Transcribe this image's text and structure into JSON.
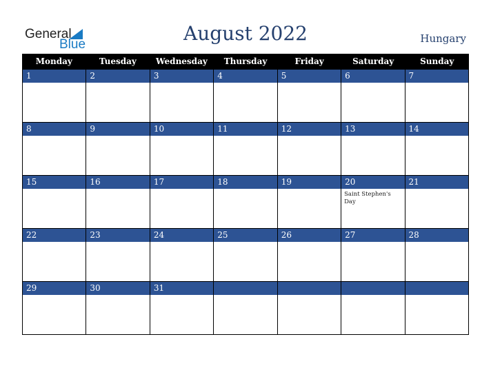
{
  "logo": {
    "general": "General",
    "blue": "Blue"
  },
  "title": "August 2022",
  "country": "Hungary",
  "weekdays": [
    "Monday",
    "Tuesday",
    "Wednesday",
    "Thursday",
    "Friday",
    "Saturday",
    "Sunday"
  ],
  "weeks": [
    [
      {
        "d": "1"
      },
      {
        "d": "2"
      },
      {
        "d": "3"
      },
      {
        "d": "4"
      },
      {
        "d": "5"
      },
      {
        "d": "6"
      },
      {
        "d": "7"
      }
    ],
    [
      {
        "d": "8"
      },
      {
        "d": "9"
      },
      {
        "d": "10"
      },
      {
        "d": "11"
      },
      {
        "d": "12"
      },
      {
        "d": "13"
      },
      {
        "d": "14"
      }
    ],
    [
      {
        "d": "15"
      },
      {
        "d": "16"
      },
      {
        "d": "17"
      },
      {
        "d": "18"
      },
      {
        "d": "19"
      },
      {
        "d": "20",
        "h": "Saint Stephen's Day"
      },
      {
        "d": "21"
      }
    ],
    [
      {
        "d": "22"
      },
      {
        "d": "23"
      },
      {
        "d": "24"
      },
      {
        "d": "25"
      },
      {
        "d": "26"
      },
      {
        "d": "27"
      },
      {
        "d": "28"
      }
    ],
    [
      {
        "d": "29"
      },
      {
        "d": "30"
      },
      {
        "d": "31"
      },
      {
        "d": ""
      },
      {
        "d": ""
      },
      {
        "d": ""
      },
      {
        "d": ""
      }
    ]
  ]
}
